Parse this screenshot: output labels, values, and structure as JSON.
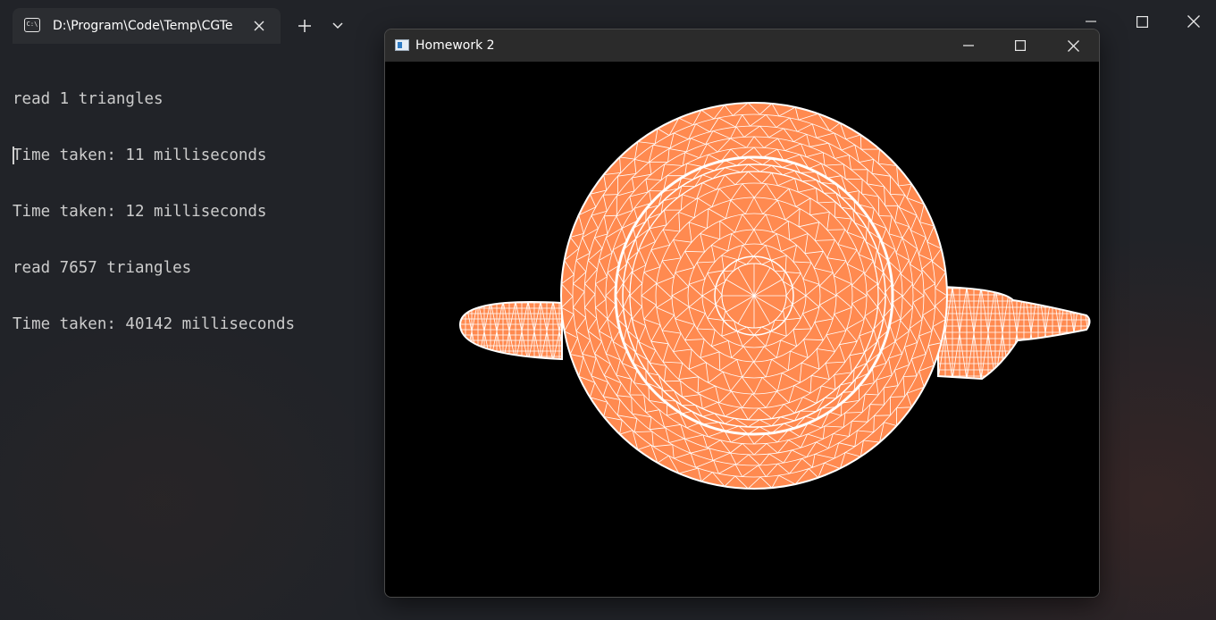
{
  "terminal": {
    "tab": {
      "title": "D:\\Program\\Code\\Temp\\CGTe",
      "icon": "terminal-icon"
    },
    "new_tab_icon": "plus-icon",
    "dropdown_icon": "chevron-down-icon",
    "window_controls": [
      "minimize-icon",
      "maximize-icon",
      "close-icon"
    ],
    "output_lines": [
      "read 1 triangles",
      "Time taken: 11 milliseconds",
      "Time taken: 12 milliseconds",
      "read 7657 triangles",
      "Time taken: 40142 milliseconds"
    ]
  },
  "render_window": {
    "title": "Homework 2",
    "icon": "app-window-icon",
    "controls": [
      "minimize-icon",
      "maximize-icon",
      "close-icon"
    ],
    "canvas": {
      "background": "#000000",
      "mesh_fill": "#ff8a50",
      "wire_color": "#ffffff",
      "content": "teapot-wireframe-top-view"
    }
  }
}
